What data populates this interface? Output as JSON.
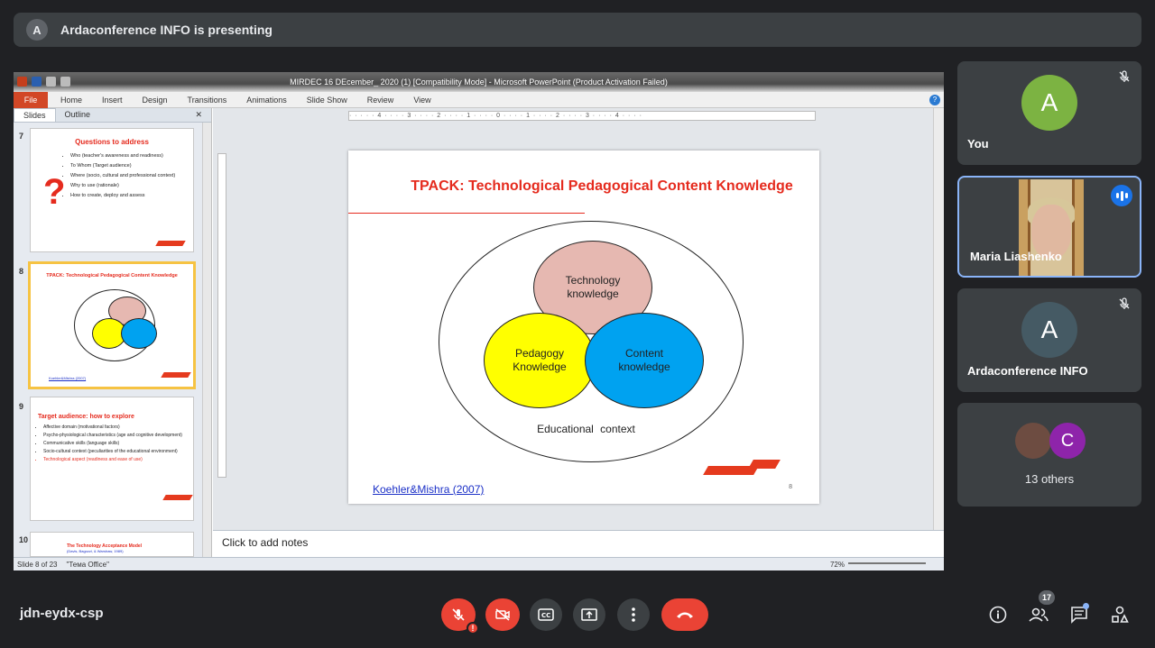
{
  "topbar": {
    "avatar_letter": "A",
    "presenting_text": "Ardaconference INFO is presenting"
  },
  "powerpoint": {
    "window_title": "MIRDEC 16 DEcember_ 2020 (1) [Compatibility Mode] - Microsoft PowerPoint (Product Activation Failed)",
    "ribbon_tabs": [
      "File",
      "Home",
      "Insert",
      "Design",
      "Transitions",
      "Animations",
      "Slide Show",
      "Review",
      "View"
    ],
    "pane_tabs": {
      "slides": "Slides",
      "outline": "Outline"
    },
    "thumbnails": [
      {
        "number": "7",
        "title": "Questions to address",
        "items": [
          "Who (teacher's awareness and readiness)",
          "To Whom (Target audience)",
          "Where (socio, cultural and professional context)",
          "Why to use (rationale)",
          "How to create, deploy and assess"
        ]
      },
      {
        "number": "8",
        "title": "TPACK: Technological Pedagogical Content Knowledge",
        "ref": "Koehler&Mishra (2007)"
      },
      {
        "number": "9",
        "title": "Target audience: how to explore",
        "items": [
          "Affective domain (motivational factors)",
          "Psycho-physiological characteristics (age and cognitive development)",
          "Communicative skills (language skills)",
          "Socio-cultural context (peculiarities of the educational environment)",
          "Technological aspect (readiness and ease of use)"
        ]
      },
      {
        "number": "10",
        "title": "The Technology Acceptance Model",
        "subtitle": "(Davis, Bagozzi, & Warshaw, 1989)"
      }
    ],
    "slide": {
      "title": "TPACK: Technological Pedagogical Content Knowledge",
      "circle_tech": "Technology knowledge",
      "circle_ped": "Pedagogy Knowledge",
      "circle_con": "Content knowledge",
      "context": "Educational context",
      "reference": "Koehler&Mishra  (2007)",
      "page_number": "8",
      "colors": {
        "tech": "#e6b8b1",
        "ped": "#ffff00",
        "con": "#00a2f0",
        "accent": "#e52b1e"
      }
    },
    "notes_placeholder": "Click to add notes",
    "status": {
      "slide_info": "Slide 8 of 23",
      "theme": "\"Тема Office\"",
      "zoom": "72%"
    }
  },
  "participants": [
    {
      "name": "You",
      "letter": "A",
      "avatar_color": "#7cb342",
      "mic": "muted"
    },
    {
      "name": "Maria Liashenko",
      "mic": "speaking"
    },
    {
      "name": "Ardaconference INFO",
      "letter": "A",
      "avatar_color": "#455a64",
      "mic": "muted"
    },
    {
      "others_label": "13 others",
      "letter": "C",
      "avatar_color": "#8e24aa"
    }
  ],
  "bottom": {
    "meeting_code": "jdn-eydx-csp",
    "people_count": "17",
    "warning_mark": "!"
  }
}
